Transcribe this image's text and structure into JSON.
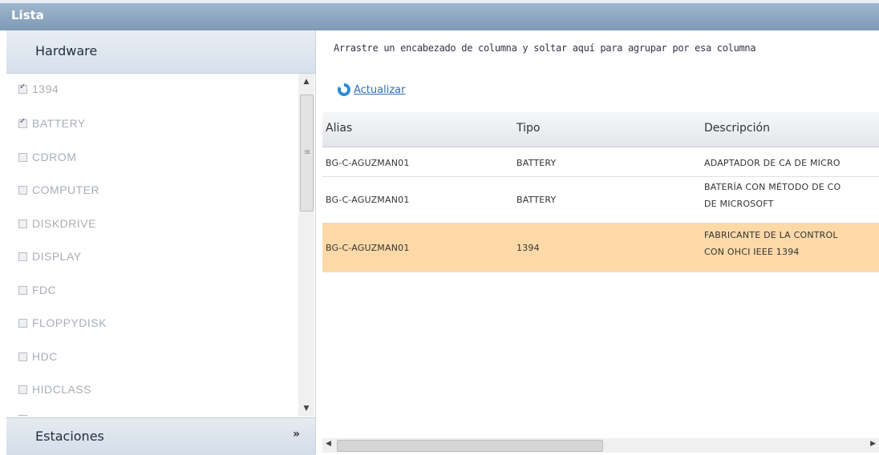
{
  "window": {
    "title": "Lista"
  },
  "left_panel": {
    "header": "Hardware",
    "footer": "Estaciones",
    "items": [
      {
        "label": "1394",
        "checked": true
      },
      {
        "label": "BATTERY",
        "checked": true
      },
      {
        "label": "CDROM",
        "checked": false
      },
      {
        "label": "COMPUTER",
        "checked": false
      },
      {
        "label": "DISKDRIVE",
        "checked": false
      },
      {
        "label": "DISPLAY",
        "checked": false
      },
      {
        "label": "FDC",
        "checked": false
      },
      {
        "label": "FLOPPYDISK",
        "checked": false
      },
      {
        "label": "HDC",
        "checked": false
      },
      {
        "label": "HIDCLASS",
        "checked": false
      }
    ]
  },
  "grid": {
    "grouping_hint": "Arrastre un encabezado de columna y soltar aquí para agrupar por esa columna",
    "refresh_label": "Actualizar",
    "columns": [
      "Alias",
      "Tipo",
      "Descripción"
    ],
    "rows": [
      {
        "alias": "BG-C-AGUZMAN01",
        "tipo": "BATTERY",
        "desc1": "ADAPTADOR DE CA DE MICRO",
        "desc2": ""
      },
      {
        "alias": "BG-C-AGUZMAN01",
        "tipo": "BATTERY",
        "desc1": "BATERÍA CON MÉTODO DE CO",
        "desc2": "DE MICROSOFT"
      },
      {
        "alias": "BG-C-AGUZMAN01",
        "tipo": "1394",
        "desc1": "FABRICANTE DE LA CONTROL",
        "desc2": "CON OHCI IEEE 1394"
      }
    ],
    "selected_row": 2,
    "selected_color": "#fdd9a7"
  },
  "colors": {
    "titlebar": "#8aa3be",
    "link": "#2f6fb8"
  }
}
